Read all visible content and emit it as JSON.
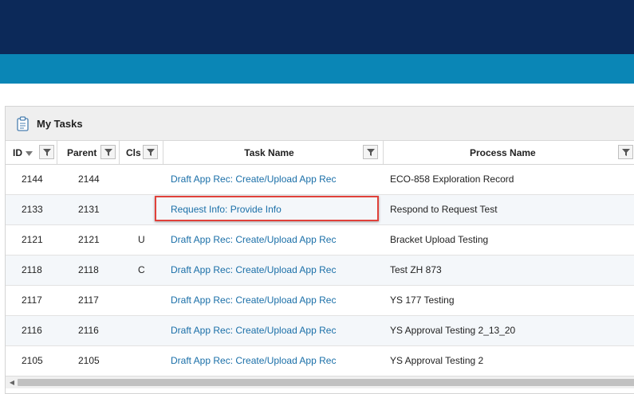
{
  "panel": {
    "title": "My Tasks"
  },
  "table": {
    "columns": {
      "id": "ID",
      "parent": "Parent",
      "cls": "Cls",
      "task_name": "Task Name",
      "process_name": "Process Name"
    },
    "sort": {
      "column": "ID",
      "direction": "descending"
    },
    "rows": [
      {
        "id": "2144",
        "parent": "2144",
        "cls": "",
        "task": "Draft App Rec: Create/Upload App Rec",
        "process": "ECO-858 Exploration Record"
      },
      {
        "id": "2133",
        "parent": "2131",
        "cls": "",
        "task": "Request Info: Provide Info",
        "process": "Respond to Request Test"
      },
      {
        "id": "2121",
        "parent": "2121",
        "cls": "U",
        "task": "Draft App Rec: Create/Upload App Rec",
        "process": "Bracket Upload Testing"
      },
      {
        "id": "2118",
        "parent": "2118",
        "cls": "C",
        "task": "Draft App Rec: Create/Upload App Rec",
        "process": "Test ZH 873"
      },
      {
        "id": "2117",
        "parent": "2117",
        "cls": "",
        "task": "Draft App Rec: Create/Upload App Rec",
        "process": "YS 177 Testing"
      },
      {
        "id": "2116",
        "parent": "2116",
        "cls": "",
        "task": "Draft App Rec: Create/Upload App Rec",
        "process": "YS Approval Testing 2_13_20"
      },
      {
        "id": "2105",
        "parent": "2105",
        "cls": "",
        "task": "Draft App Rec: Create/Upload App Rec",
        "process": "YS Approval Testing 2"
      }
    ]
  },
  "colors": {
    "header_dark": "#0c2959",
    "header_accent": "#0a86b6",
    "link": "#1a6fa8",
    "highlight": "#e0413a"
  },
  "icons": {
    "panel": "clipboard-icon",
    "filter": "filter-icon",
    "sort": "sort-down-icon",
    "scroll": "scroll-left-icon"
  }
}
